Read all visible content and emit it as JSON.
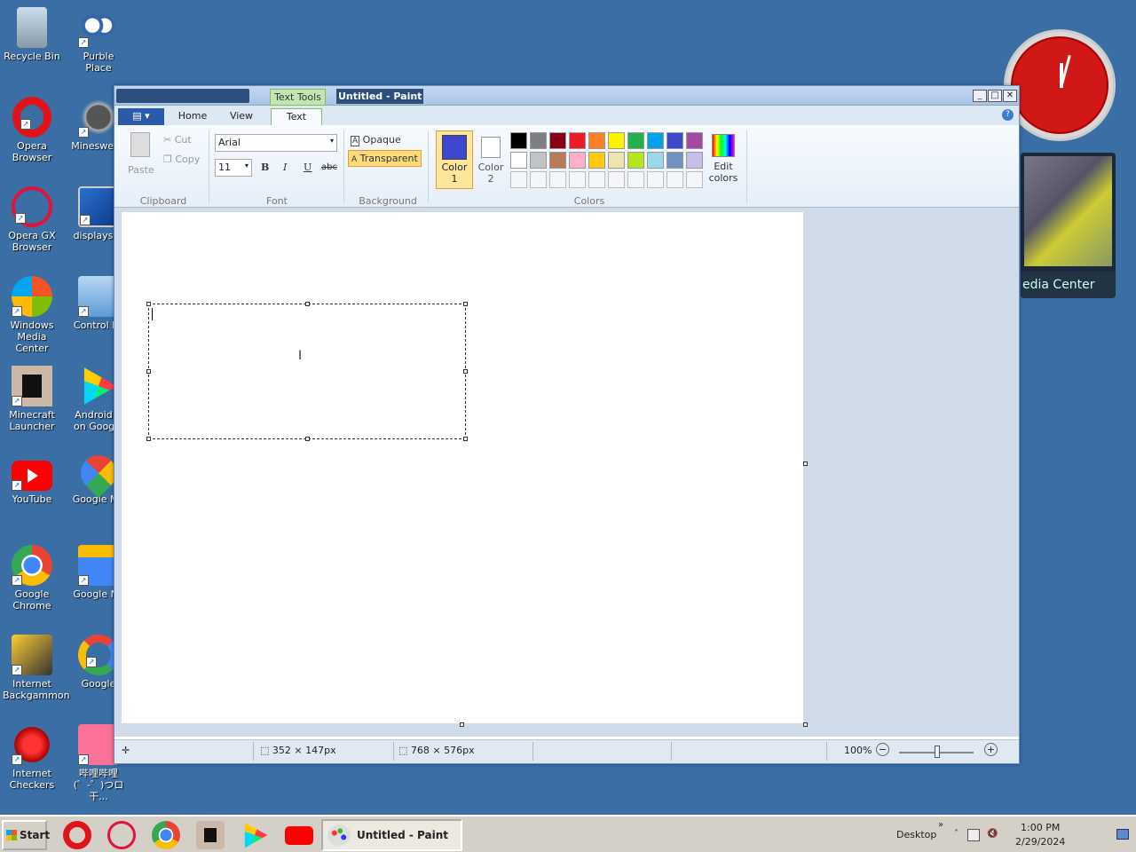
{
  "desktop": {
    "icons": [
      {
        "label": "Recycle Bin",
        "name": "recycle-bin"
      },
      {
        "label": "Purble Place",
        "name": "purble-place"
      },
      {
        "label": "Opera Browser",
        "name": "opera-browser"
      },
      {
        "label": "Minesweeper",
        "name": "minesweeper",
        "shown": "Minesweep"
      },
      {
        "label": "Opera GX Browser",
        "name": "opera-gx-browser"
      },
      {
        "label": "displayswi",
        "name": "displayswitch"
      },
      {
        "label": "Windows Media Center",
        "name": "windows-media-center"
      },
      {
        "label": "Control Pa",
        "name": "control-panel"
      },
      {
        "label": "Minecraft Launcher",
        "name": "minecraft-launcher"
      },
      {
        "label": "Android A on Google",
        "name": "android-apps"
      },
      {
        "label": "YouTube",
        "name": "youtube"
      },
      {
        "label": "Google Ma",
        "name": "google-maps"
      },
      {
        "label": "Google Chrome",
        "name": "google-chrome"
      },
      {
        "label": "Google Ne",
        "name": "google-news"
      },
      {
        "label": "Internet Backgammon",
        "name": "internet-backgammon"
      },
      {
        "label": "Google",
        "name": "google"
      },
      {
        "label": "Internet Checkers",
        "name": "internet-checkers"
      },
      {
        "label": "哔哩哔哩 (゜-゜)つロ 干...",
        "name": "bilibili"
      }
    ]
  },
  "gadgets": {
    "media_center_label": "edia Center"
  },
  "window": {
    "title": "Untitled - Paint",
    "context_tab": "Text Tools",
    "tabs": {
      "home": "Home",
      "view": "View",
      "text": "Text"
    },
    "clipboard": {
      "paste": "Paste",
      "cut": "Cut",
      "copy": "Copy",
      "group": "Clipboard"
    },
    "font": {
      "family": "Arial",
      "size": "11",
      "bold": "B",
      "italic": "I",
      "underline": "U",
      "strike": "abc",
      "group": "Font"
    },
    "background": {
      "opaque": "Opaque",
      "transparent": "Transparent",
      "group": "Background"
    },
    "colors": {
      "color1_label": "Color\n1",
      "color1_a": "Color",
      "color1_b": "1",
      "color2_a": "Color",
      "color2_b": "2",
      "edit_a": "Edit",
      "edit_b": "colors",
      "group": "Colors",
      "color1": "#3f48cc",
      "color2": "#ffffff",
      "palette_row1": [
        "#000000",
        "#7f7f7f",
        "#880015",
        "#ed1c24",
        "#ff7f27",
        "#fff200",
        "#22b14c",
        "#00a2e8",
        "#3f48cc",
        "#a349a4"
      ],
      "palette_row2": [
        "#ffffff",
        "#c3c3c3",
        "#b97a57",
        "#ffaec9",
        "#ffc90e",
        "#efe4b0",
        "#b5e61d",
        "#99d9ea",
        "#7092be",
        "#c8bfe7"
      ]
    },
    "status": {
      "selection_size": "352 × 147px",
      "image_size": "768 × 576px",
      "zoom": "100%"
    }
  },
  "taskbar": {
    "start": "Start",
    "task": "Untitled - Paint",
    "desktop": "Desktop",
    "time": "1:00 PM",
    "date": "2/29/2024"
  }
}
